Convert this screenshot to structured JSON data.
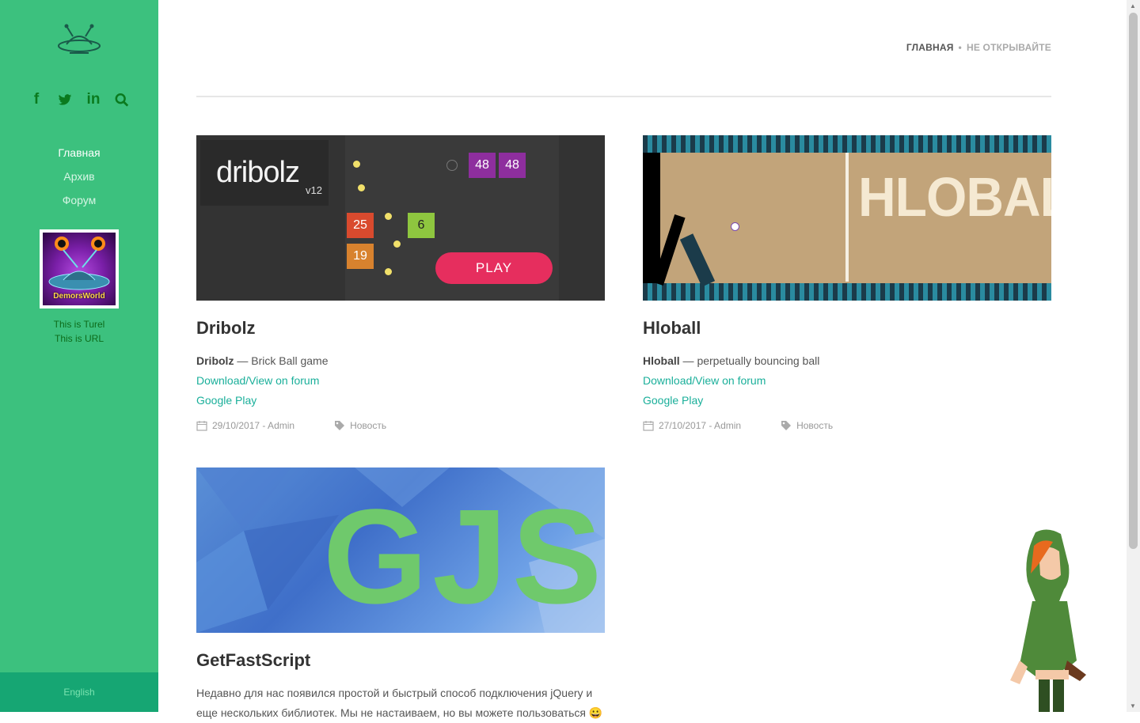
{
  "sidebar": {
    "nav": [
      {
        "label": "Главная",
        "active": true
      },
      {
        "label": "Архив",
        "active": false
      },
      {
        "label": "Форум",
        "active": false
      }
    ],
    "avatar_text": "DemorsWorld",
    "tagline": [
      "This is Turel",
      "This is URL"
    ],
    "language": "English",
    "social_icons": [
      "facebook-icon",
      "twitter-icon",
      "linkedin-icon",
      "search-icon"
    ]
  },
  "breadcrumbs": {
    "home": "ГЛАВНАЯ",
    "separator": "•",
    "current": "НЕ ОТКРЫВАЙТЕ"
  },
  "posts": [
    {
      "title": "Dribolz",
      "excerpt_bold": "Dribolz",
      "excerpt_rest": " — Brick Ball game",
      "link1": "Download/View on forum",
      "link2": "Google Play",
      "date_author": "29/10/2017 - Admin",
      "category": "Новость",
      "thumb": {
        "logo": "dribolz",
        "version": "v12",
        "blocks": [
          "48",
          "48",
          "25",
          "6",
          "19"
        ],
        "play": "PLAY"
      }
    },
    {
      "title": "Hloball",
      "excerpt_bold": "Hloball",
      "excerpt_rest": " — perpetually bouncing ball",
      "link1": "Download/View on forum",
      "link2": "Google Play",
      "date_author": "27/10/2017 - Admin",
      "category": "Новость",
      "thumb": {
        "logo": "HLOBALL"
      }
    },
    {
      "title": "GetFastScript",
      "excerpt": "Недавно для нас появился простой и быстрый способ подключения jQuery  и еще нескольких библиотек. Мы не настаиваем, но вы можете пользоваться 😀",
      "thumb": {
        "logo": "GJS"
      }
    }
  ],
  "colors": {
    "sidebar": "#3cc17e",
    "sidebar_footer": "#16a673",
    "link": "#1aaf9a",
    "social": "#0a7a1e"
  }
}
